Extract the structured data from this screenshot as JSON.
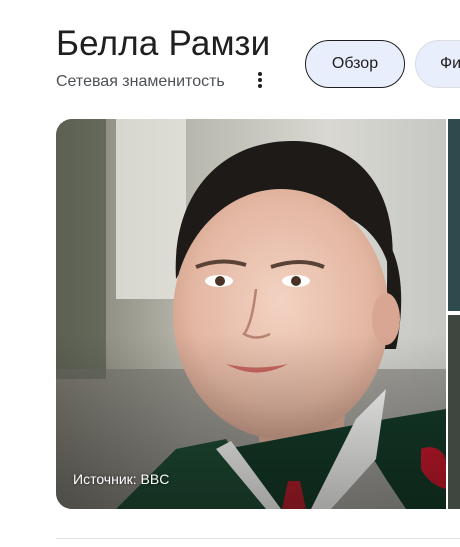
{
  "header": {
    "title": "Белла Рамзи",
    "subtitle": "Сетевая знаменитость",
    "more_icon": "more-vert-icon"
  },
  "tabs": [
    {
      "label": "Обзор",
      "selected": true
    },
    {
      "label": "Фи",
      "selected": false
    }
  ],
  "image": {
    "source_label": "Источник: BBC"
  },
  "colors": {
    "chip_bg": "#e8eefc",
    "text_primary": "#1f1f1f",
    "text_secondary": "#4d5156"
  }
}
